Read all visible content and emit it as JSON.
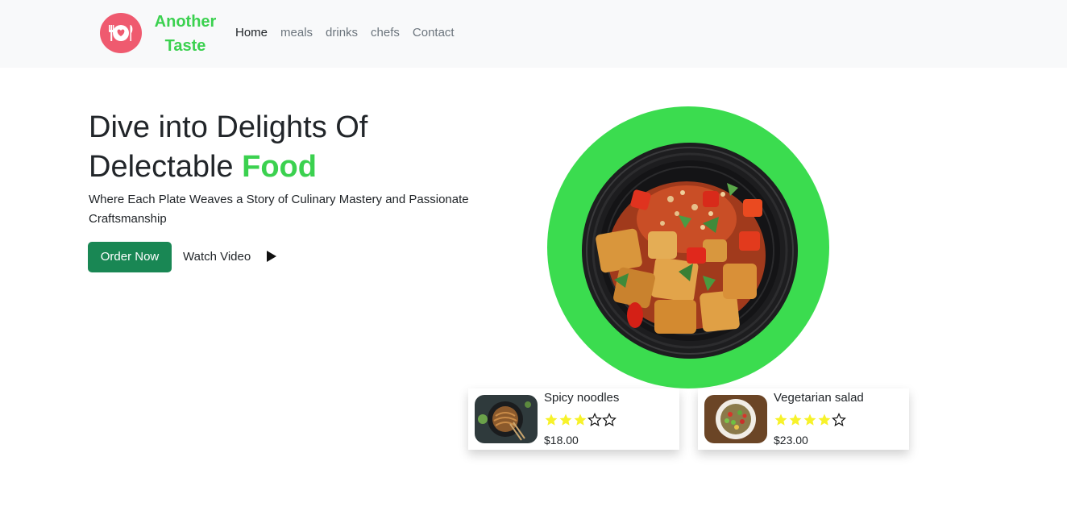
{
  "nav": {
    "brand": "Another Taste",
    "brand_line1": "Another",
    "brand_line2": "Taste",
    "logo_icon": "plate-heart-icon",
    "links": [
      {
        "label": "Home",
        "active": true
      },
      {
        "label": "meals",
        "active": false
      },
      {
        "label": "drinks",
        "active": false
      },
      {
        "label": "chefs",
        "active": false
      },
      {
        "label": "Contact",
        "active": false
      }
    ]
  },
  "hero": {
    "title_line1": "Dive into Delights Of",
    "title_line2_prefix": "Delectable",
    "title_accent": "Food",
    "subtitle": "Where Each Plate Weaves a Story of Culinary Mastery and Passionate Craftsmanship",
    "order_button": "Order Now",
    "watch_video": "Watch Video",
    "play_icon": "play-icon"
  },
  "cards": [
    {
      "title": "Spicy noodles",
      "rating": 3,
      "max_rating": 5,
      "price": "$18.00",
      "thumb_icon": "noodles-thumbnail"
    },
    {
      "title": "Vegetarian salad",
      "rating": 4,
      "max_rating": 5,
      "price": "$23.00",
      "thumb_icon": "salad-thumbnail"
    }
  ],
  "colors": {
    "accent": "#3bd14f",
    "circle": "#3bdc4f",
    "button": "#198754",
    "logo": "#ef5a6f",
    "star": "#f7f22a",
    "navbar_bg": "#f8f9fa"
  }
}
